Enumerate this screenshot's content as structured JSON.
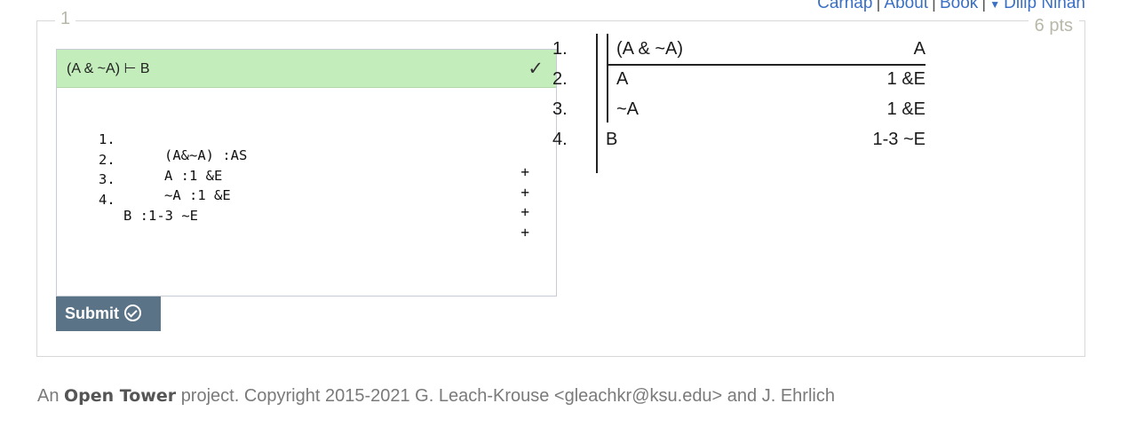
{
  "nav": {
    "items": [
      "Carnap",
      "About",
      "Book"
    ],
    "user": "Dilip Ninan"
  },
  "exercise": {
    "number": "1",
    "points": "6 pts",
    "sequent": "(A & ~A) ⊢ B",
    "check": "✓",
    "code_lines": [
      {
        "num": "1.",
        "text": "(A&~A) :AS",
        "plus": "+"
      },
      {
        "num": "2.",
        "text": "A :1 &E",
        "plus": "+"
      },
      {
        "num": "3.",
        "text": "~A :1 &E",
        "plus": "+"
      },
      {
        "num": "4.",
        "text": "B :1-3 ~E",
        "plus": "+"
      }
    ],
    "submit_label": "Submit"
  },
  "proof": {
    "lines": [
      {
        "num": "1.",
        "formula": "(A & ~A)",
        "justification": "A"
      },
      {
        "num": "2.",
        "formula": "A",
        "justification": "1 &E"
      },
      {
        "num": "3.",
        "formula": "~A",
        "justification": "1 &E"
      },
      {
        "num": "4.",
        "formula": "B",
        "justification": "1-3 ~E"
      }
    ]
  },
  "footer": {
    "prefix": "An",
    "brand": "Open Tower",
    "rest": "project. Copyright 2015-2021 G. Leach-Krouse <gleachkr@ksu.edu> and J. Ehrlich"
  },
  "colors": {
    "header_success": "#c3eebc",
    "submit_bg": "#5b7387",
    "link": "#3a6fc4"
  },
  "icons": [
    "checkmark-icon",
    "submit-check-circle-icon",
    "caret-down-icon"
  ]
}
